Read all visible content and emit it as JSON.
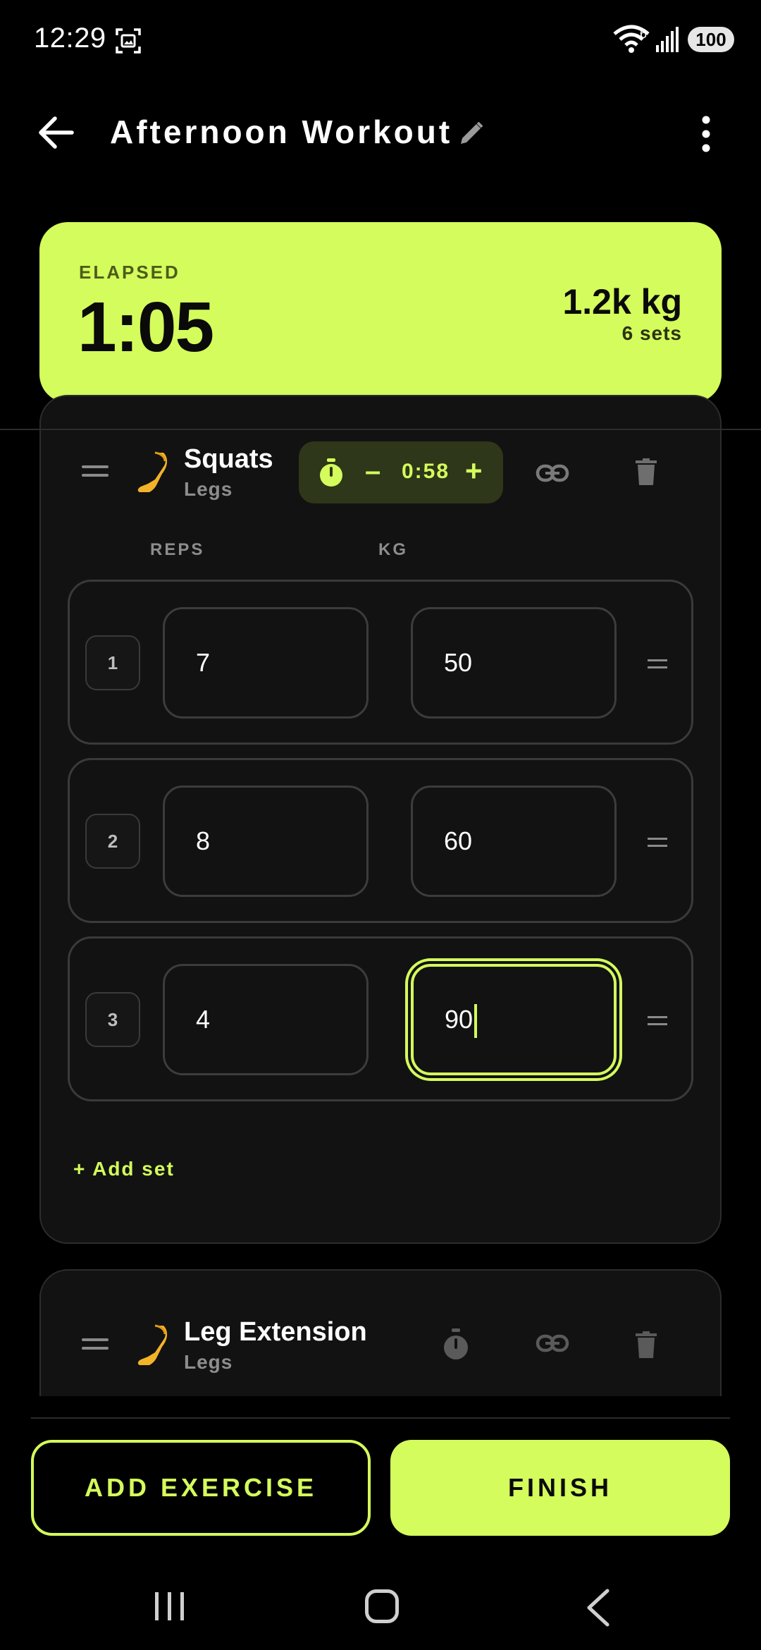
{
  "status_bar": {
    "time": "12:29",
    "wifi_badge": "6",
    "battery": "100",
    "icons": [
      "screenshot-icon",
      "wifi-icon",
      "signal-icon",
      "battery-icon"
    ]
  },
  "header": {
    "title": "Afternoon Workout",
    "icons": [
      "back-arrow-icon",
      "pencil-icon",
      "more-vert-icon"
    ]
  },
  "summary": {
    "elapsed_label": "ELAPSED",
    "elapsed": "1:05",
    "volume": "1.2k kg",
    "sets": "6 sets"
  },
  "exercises": [
    {
      "name": "Squats",
      "category": "Legs",
      "rest_timer": "0:58",
      "timer_minus": "–",
      "timer_plus": "+",
      "columns": {
        "reps": "REPS",
        "kg": "KG"
      },
      "sets": [
        {
          "number": "1",
          "reps": "7",
          "kg": "50"
        },
        {
          "number": "2",
          "reps": "8",
          "kg": "60"
        },
        {
          "number": "3",
          "reps": "4",
          "kg": "90"
        }
      ],
      "add_set": "+ Add set"
    },
    {
      "name": "Leg Extension",
      "category": "Legs"
    }
  ],
  "actions": {
    "add_exercise": "ADD EXERCISE",
    "finish": "FINISH"
  },
  "colors": {
    "accent": "#d4fc5c",
    "background": "#000000",
    "card": "#121212"
  }
}
